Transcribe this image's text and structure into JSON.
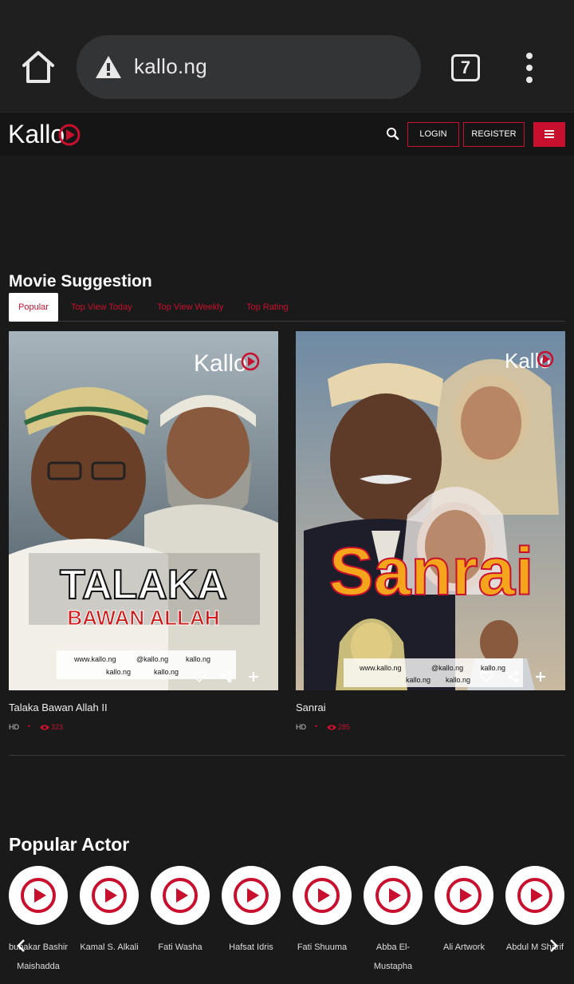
{
  "browser": {
    "url": "kallo.ng",
    "tab_count": "7"
  },
  "site_nav": {
    "logo_text": "Kallo",
    "login_label": "LOGIN",
    "register_label": "REGISTER"
  },
  "colors": {
    "accent": "#c8102e",
    "background": "#1a1a1a"
  },
  "movie_section": {
    "title": "Movie Suggestion",
    "tabs": [
      {
        "label": "Popular",
        "active": true
      },
      {
        "label": "Top View Today",
        "active": false
      },
      {
        "label": "Top View Weekly",
        "active": false
      },
      {
        "label": "Top Rating",
        "active": false
      }
    ],
    "movies": [
      {
        "title": "Talaka Bawan Allah II",
        "quality": "HD",
        "views": "323",
        "poster_text": [
          "TALAKA",
          "BAWAN ALLAH"
        ],
        "poster_logo": "Kallo",
        "poster_socials": [
          "www.kallo.ng",
          "@kallo.ng",
          "kallo.ng",
          "kallo.ng",
          "kallo.ng"
        ]
      },
      {
        "title": "Sanrai",
        "quality": "HD",
        "views": "285",
        "poster_text": [
          "Sanrai"
        ],
        "poster_logo": "Kallo",
        "poster_socials": [
          "www.kallo.ng",
          "@kallo.ng",
          "kallo.ng",
          "kallo.ng",
          "kallo.ng"
        ]
      }
    ]
  },
  "actor_section": {
    "title": "Popular Actor",
    "actors": [
      {
        "name": "bubakar Bashir Maishadda"
      },
      {
        "name": "Kamal S. Alkali"
      },
      {
        "name": "Fati Washa"
      },
      {
        "name": "Hafsat Idris"
      },
      {
        "name": "Fati Shuuma"
      },
      {
        "name": "Abba El-Mustapha"
      },
      {
        "name": "Ali Artwork"
      },
      {
        "name": "Abdul M Sharif"
      }
    ]
  }
}
